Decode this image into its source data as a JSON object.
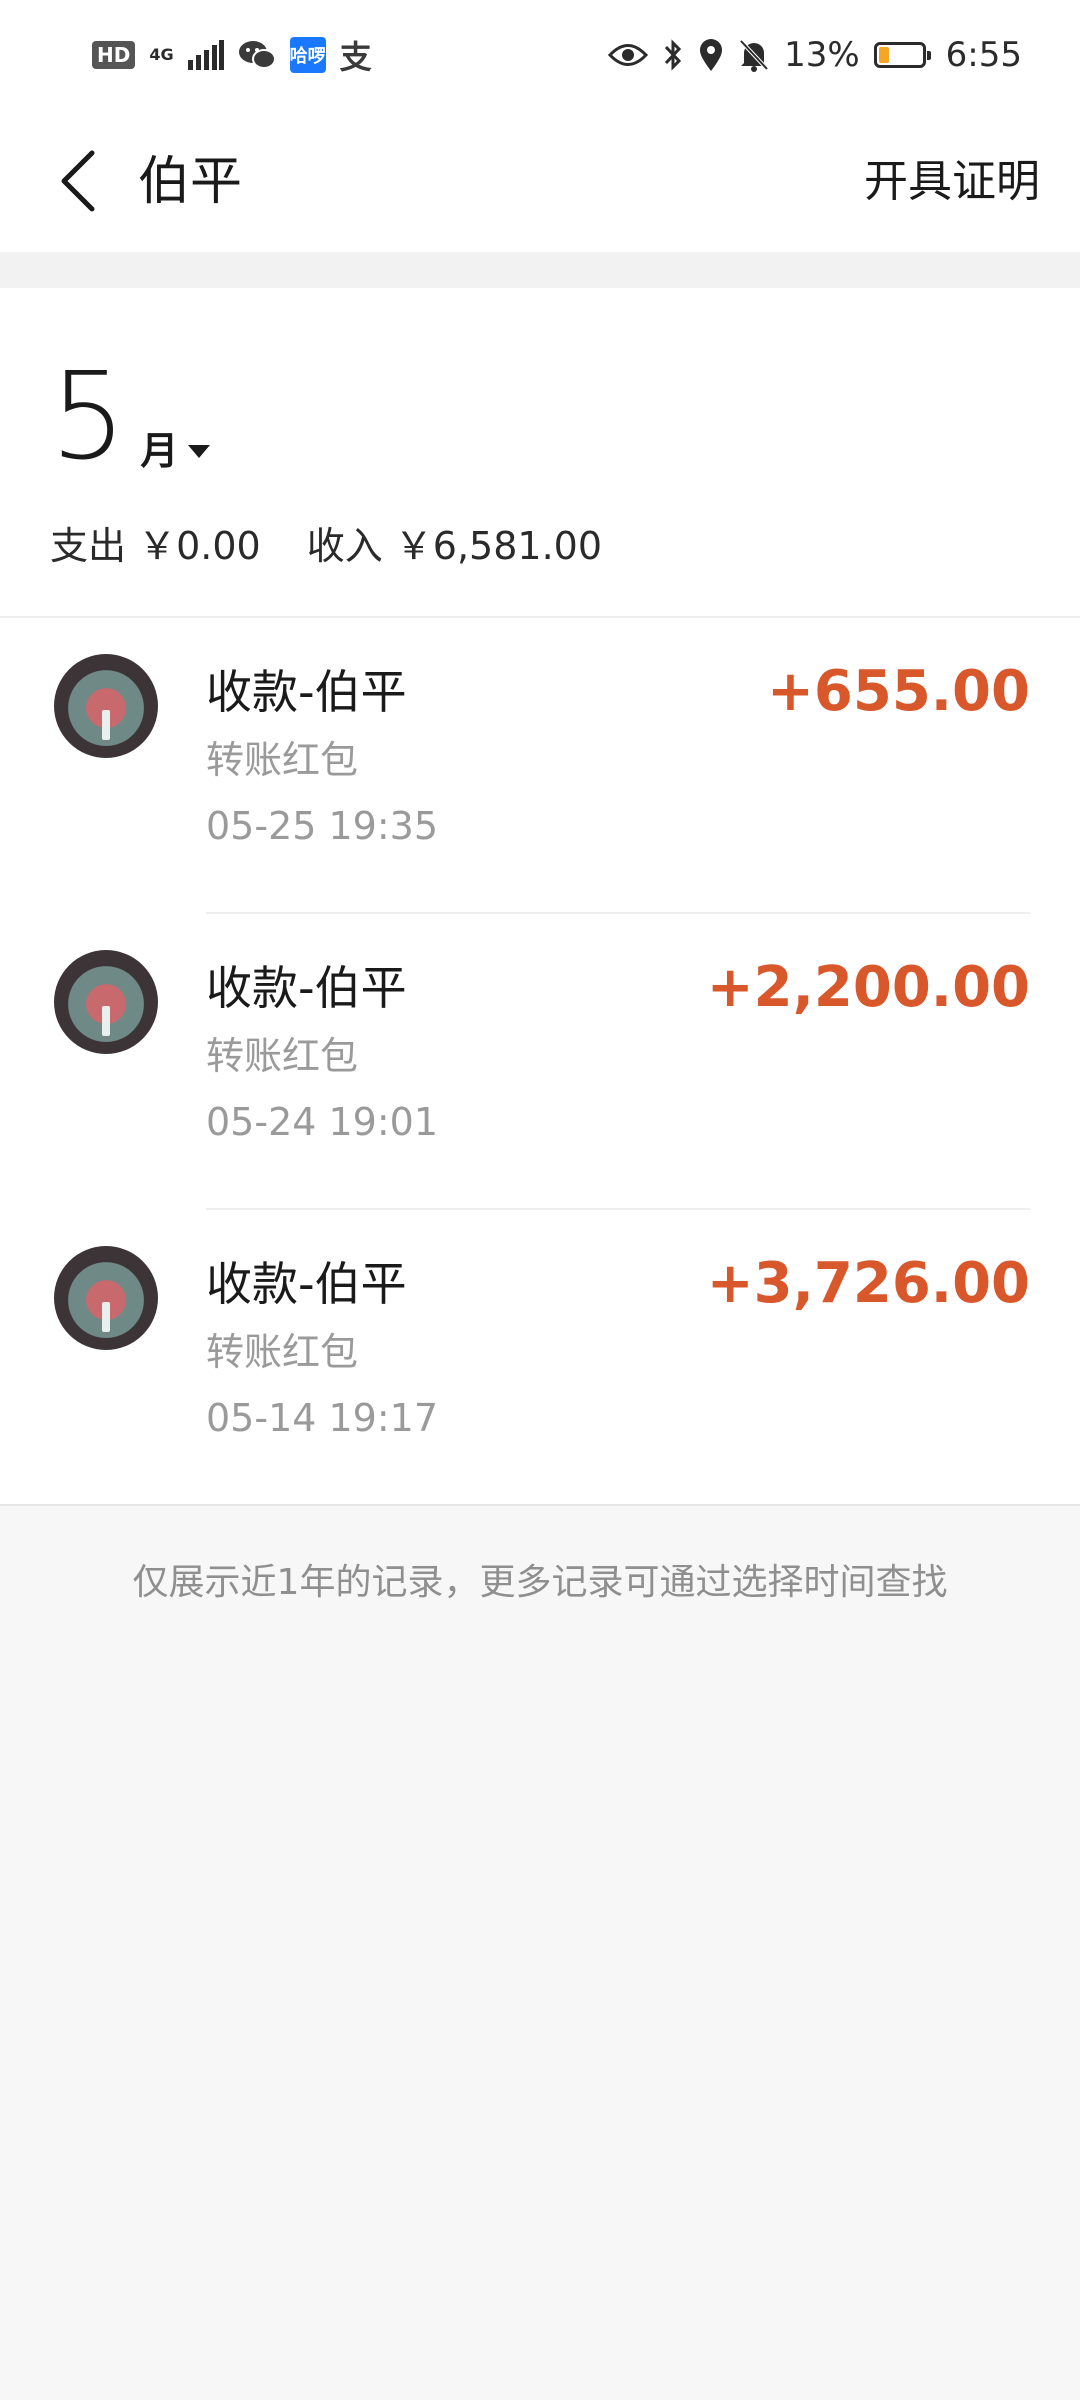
{
  "status_bar": {
    "hd": "HD",
    "network": "4G",
    "app_badge": "哈啰",
    "alipay_glyph": "支",
    "battery": "13%",
    "time": "6:55",
    "battery_level": 0.13
  },
  "header": {
    "title": "伯平",
    "action": "开具证明"
  },
  "month": {
    "number": "5",
    "unit": "月",
    "expense": "支出 ￥0.00",
    "income": "收入 ￥6,581.00"
  },
  "transactions": [
    {
      "title": "收款-伯平",
      "subtitle": "转账红包",
      "time": "05-25  19:35",
      "amount": "+655.00"
    },
    {
      "title": "收款-伯平",
      "subtitle": "转账红包",
      "time": "05-24  19:01",
      "amount": "+2,200.00"
    },
    {
      "title": "收款-伯平",
      "subtitle": "转账红包",
      "time": "05-14  19:17",
      "amount": "+3,726.00"
    }
  ],
  "footer_note": "仅展示近1年的记录，更多记录可通过选择时间查找",
  "colors": {
    "amount": "#d9582b",
    "muted_text": "#9a9a9a",
    "background": "#f7f7f7"
  }
}
